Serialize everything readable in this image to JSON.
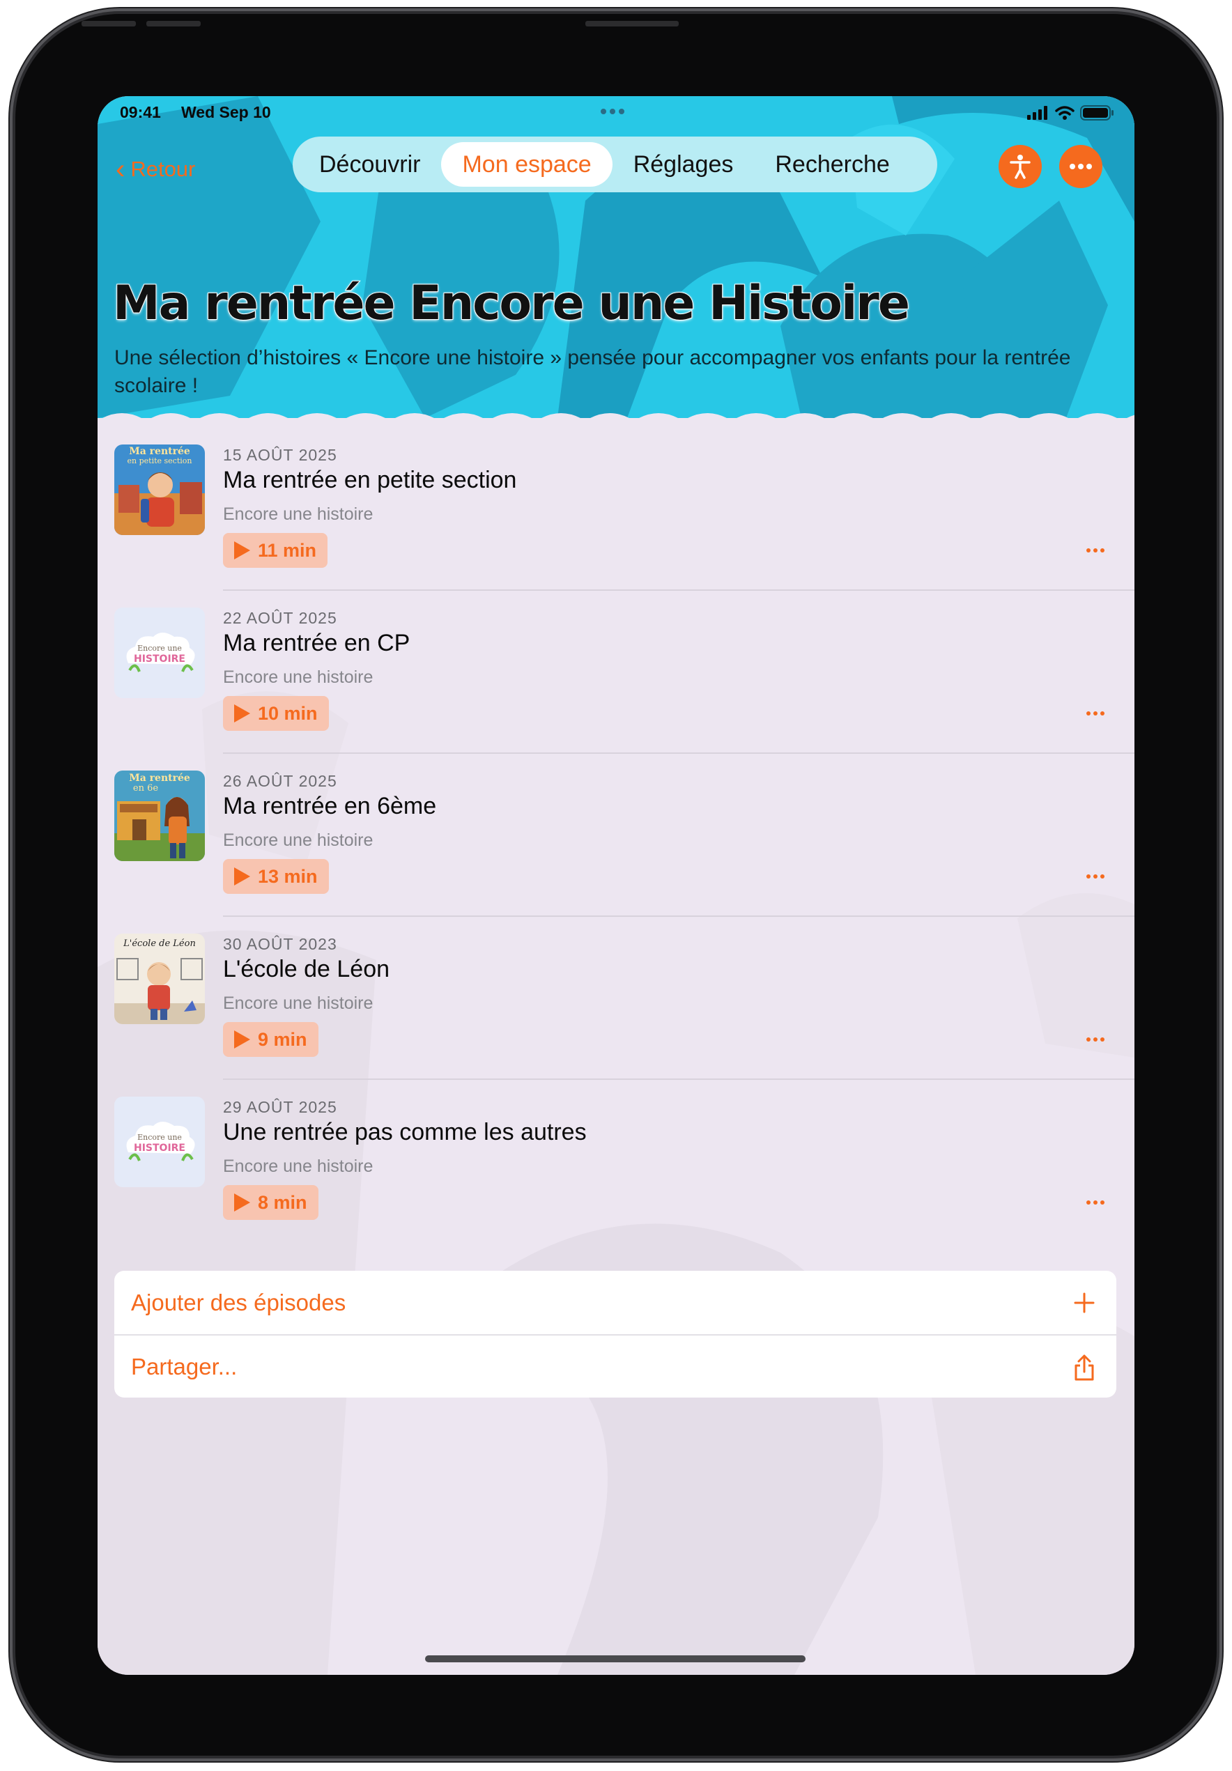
{
  "status_bar": {
    "time": "09:41",
    "date": "Wed Sep 10"
  },
  "nav": {
    "back_label": "Retour",
    "tabs": [
      {
        "label": "Découvrir",
        "active": false
      },
      {
        "label": "Mon espace",
        "active": true
      },
      {
        "label": "Réglages",
        "active": false
      },
      {
        "label": "Recherche",
        "active": false
      }
    ],
    "accessibility_icon": "accessibility-icon",
    "more_icon": "ellipsis-icon"
  },
  "playlist": {
    "title": "Ma rentrée Encore une Histoire",
    "description": "Une sélection d’histoires « Encore une histoire » pensée pour accompagner vos enfants pour la rentrée scolaire !"
  },
  "episodes": [
    {
      "date": "15 AOÛT 2025",
      "title": "Ma rentrée en petite section",
      "show": "Encore une histoire",
      "duration": "11 min",
      "thumb_caption": "Ma rentrée en petite section"
    },
    {
      "date": "22 AOÛT 2025",
      "title": "Ma rentrée en CP",
      "show": "Encore une histoire",
      "duration": "10 min",
      "thumb_caption": "Encore une HISTOIRE"
    },
    {
      "date": "26 AOÛT 2025",
      "title": "Ma rentrée en 6ème",
      "show": "Encore une histoire",
      "duration": "13 min",
      "thumb_caption": "Ma rentrée en 6e"
    },
    {
      "date": "30 AOÛT 2023",
      "title": "L'école de Léon",
      "show": "Encore une histoire",
      "duration": "9 min",
      "thumb_caption": "L'école de Léon"
    },
    {
      "date": "29 AOÛT 2025",
      "title": "Une rentrée pas comme les autres",
      "show": "Encore une histoire",
      "duration": "8 min",
      "thumb_caption": "Encore une HISTOIRE"
    }
  ],
  "actions": {
    "add_label": "Ajouter des épisodes",
    "share_label": "Partager..."
  },
  "colors": {
    "accent": "#f56a1e",
    "header": "#28c8e6",
    "background": "#ede6f1"
  }
}
